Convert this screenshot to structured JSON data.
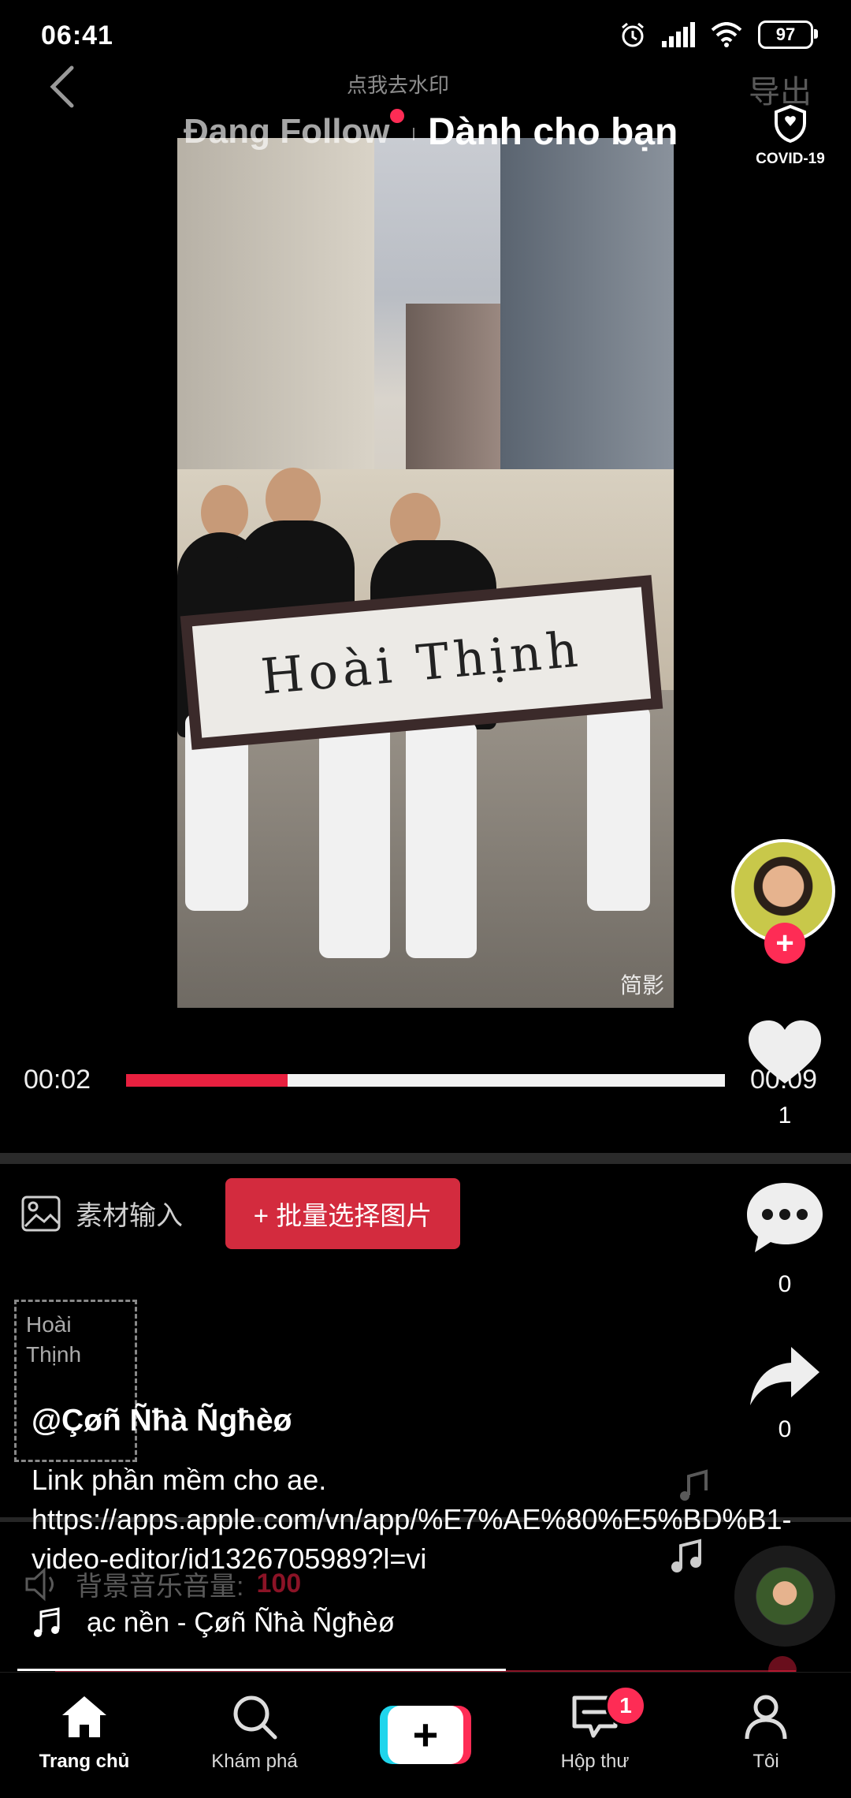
{
  "status_bar": {
    "time": "06:41",
    "battery": "97"
  },
  "header": {
    "watermark_text": "点我去水印",
    "export_text": "导出",
    "tab_following": "Đang Follow",
    "tab_for_you": "Dành cho bạn",
    "covid_label": "COVID-19"
  },
  "video": {
    "sign_text": "Hoài Thịnh",
    "corner_watermark": "简影"
  },
  "player": {
    "current_time": "00:02",
    "total_time": "00:09",
    "progress": 0.27
  },
  "editor": {
    "material_label": "素材输入",
    "batch_button": "+ 批量选择图片",
    "preview_line1": "Hoài",
    "preview_line2": "Thịnh",
    "bgm_label": "背景音乐音量:",
    "bgm_value": "100"
  },
  "post": {
    "username": "@Çøñ Ñħà Ñgħèø",
    "caption": "Link phần mềm cho ae.   https://apps.apple.com/vn/app/%E7%AE%80%E5%BD%B1-video-editor/id1326705989?l=vi",
    "music": "ạc nền - Çøñ Ñħà Ñgħèø"
  },
  "actions": {
    "likes": "1",
    "comments": "0",
    "shares": "0"
  },
  "nav": {
    "home": "Trang chủ",
    "discover": "Khám phá",
    "inbox": "Hộp thư",
    "inbox_badge": "1",
    "me": "Tôi"
  },
  "colors": {
    "accent": "#fe2c55",
    "accent_alt": "#20d5ec",
    "progress_red": "#e8203f"
  }
}
